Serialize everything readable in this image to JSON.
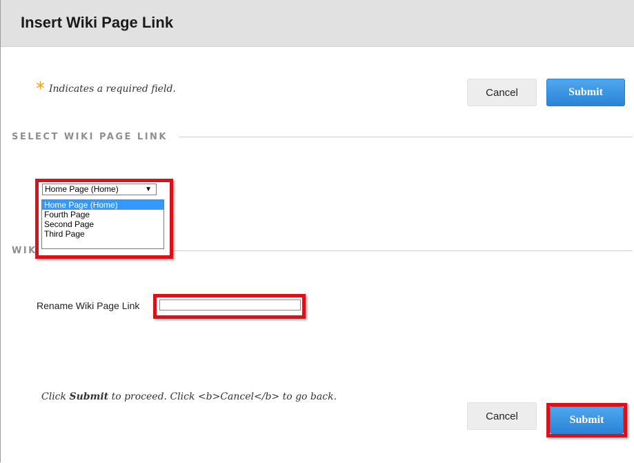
{
  "header": {
    "title": "Insert Wiki Page Link"
  },
  "required_note": {
    "symbol": "*",
    "text": "Indicates a required field."
  },
  "top_actions": {
    "cancel_label": "Cancel",
    "submit_label": "Submit"
  },
  "section_select": {
    "title": "SELECT WIKI PAGE LINK"
  },
  "page_select": {
    "selected": "Home Page (Home)",
    "options": [
      "Home Page (Home)",
      "Fourth Page",
      "Second Page",
      "Third Page"
    ]
  },
  "section_options": {
    "title": "WIKI PAGE OPTIONS"
  },
  "rename_field": {
    "label": "Rename Wiki Page Link",
    "value": ""
  },
  "instructions": {
    "prefix": "Click ",
    "submit_word": "Submit",
    "suffix": " to proceed. Click <b>Cancel</b> to go back."
  },
  "bottom_actions": {
    "cancel_label": "Cancel",
    "submit_label": "Submit"
  },
  "colors": {
    "accent": "#2b83d6",
    "highlight": "#d8121b",
    "required": "#f7a11a"
  }
}
